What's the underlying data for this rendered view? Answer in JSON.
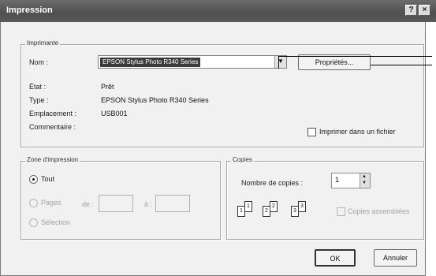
{
  "window": {
    "title": "Impression",
    "help_glyph": "?",
    "close_glyph": "×"
  },
  "printer": {
    "group_label": "Imprimante",
    "name_label": "Nom :",
    "name_value": "EPSON Stylus Photo R340 Series",
    "properties_button": "Propriétés...",
    "state_label": "État :",
    "state_value": "Prêt",
    "type_label": "Type :",
    "type_value": "EPSON Stylus Photo R340 Series",
    "location_label": "Emplacement :",
    "location_value": "USB001",
    "comment_label": "Commentaire :",
    "print_to_file_label": "Imprimer dans un fichier"
  },
  "print_range": {
    "group_label": "Zone d'impression",
    "all_label": "Tout",
    "pages_label": "Pages",
    "from_label": "de :",
    "to_label": "à :",
    "selection_label": "Sélection"
  },
  "copies": {
    "group_label": "Copies",
    "count_label": "Nombre de copies :",
    "count_value": "1",
    "collate_label": "Copies assemblées",
    "page_numbers": [
      "1",
      "1",
      "2",
      "2",
      "3",
      "3"
    ]
  },
  "buttons": {
    "ok": "OK",
    "cancel": "Annuler"
  },
  "icons": [
    "chevron-down-icon",
    "spin-up-icon",
    "spin-down-icon"
  ]
}
